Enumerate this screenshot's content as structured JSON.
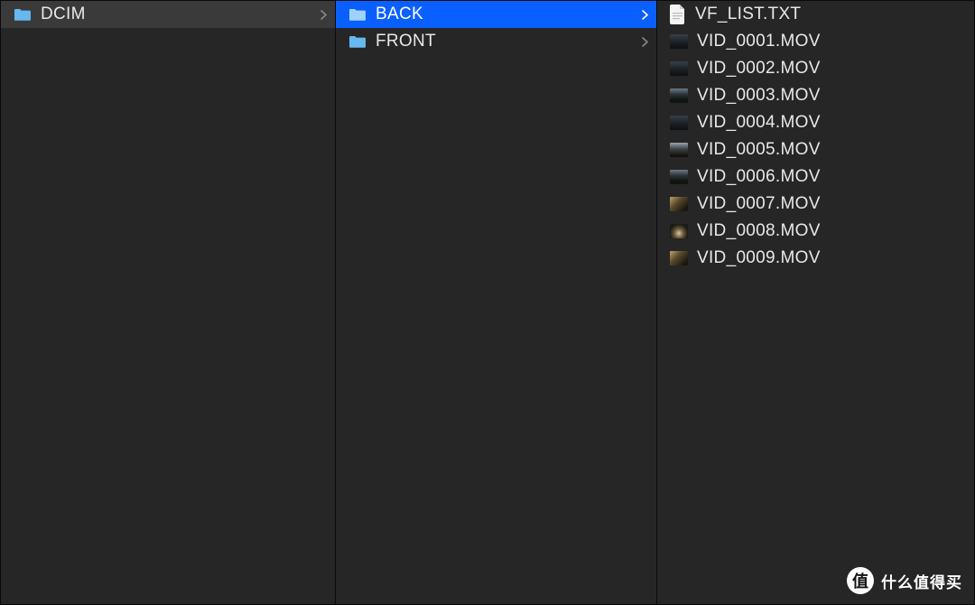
{
  "col1": {
    "items": [
      {
        "label": "DCIM",
        "type": "folder",
        "state": "selected-dim",
        "nav": true
      }
    ]
  },
  "col2": {
    "items": [
      {
        "label": "BACK",
        "type": "folder",
        "state": "selected",
        "nav": true
      },
      {
        "label": "FRONT",
        "type": "folder",
        "state": "",
        "nav": true
      }
    ]
  },
  "col3": {
    "items": [
      {
        "label": "VF_LIST.TXT",
        "type": "doc"
      },
      {
        "label": "VID_0001.MOV",
        "type": "thumb",
        "grad": "grad1"
      },
      {
        "label": "VID_0002.MOV",
        "type": "thumb",
        "grad": "grad1"
      },
      {
        "label": "VID_0003.MOV",
        "type": "thumb",
        "grad": "grad3"
      },
      {
        "label": "VID_0004.MOV",
        "type": "thumb",
        "grad": "grad1"
      },
      {
        "label": "VID_0005.MOV",
        "type": "thumb",
        "grad": "grad5"
      },
      {
        "label": "VID_0006.MOV",
        "type": "thumb",
        "grad": "grad3"
      },
      {
        "label": "VID_0007.MOV",
        "type": "thumb",
        "grad": "grad4"
      },
      {
        "label": "VID_0008.MOV",
        "type": "thumb",
        "grad": "grad2"
      },
      {
        "label": "VID_0009.MOV",
        "type": "thumb",
        "grad": "grad4"
      }
    ]
  },
  "watermark": {
    "badge": "值",
    "text": "什么值得买"
  },
  "colors": {
    "folder": "#67b7f0",
    "folder_selected": "#9fd3fb",
    "selection": "#0a60ff"
  }
}
